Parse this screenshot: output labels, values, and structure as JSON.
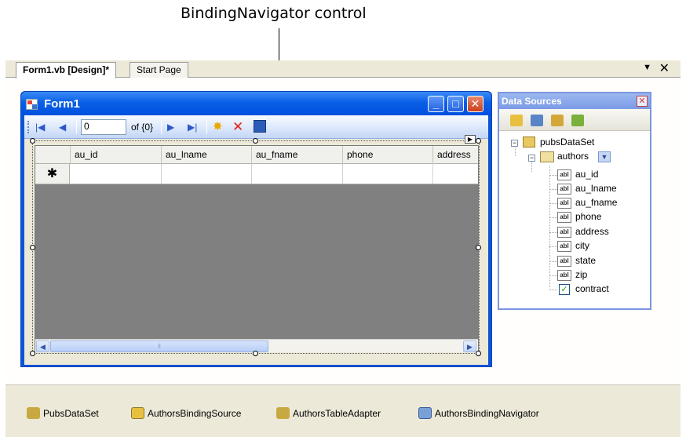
{
  "callout": {
    "label": "BindingNavigator control"
  },
  "document_tabs": [
    {
      "label": "Form1.vb [Design]*",
      "active": true
    },
    {
      "label": "Start Page",
      "active": false
    }
  ],
  "form": {
    "caption": "Form1",
    "navigator": {
      "position_value": "0",
      "count_label": "of {0}"
    },
    "grid": {
      "columns": [
        "au_id",
        "au_lname",
        "au_fname",
        "phone",
        "address"
      ],
      "new_row_marker": "✱"
    }
  },
  "data_sources": {
    "title": "Data Sources",
    "dataset": "pubsDataSet",
    "table": "authors",
    "fields": [
      {
        "name": "au_id",
        "kind": "abl"
      },
      {
        "name": "au_lname",
        "kind": "abl"
      },
      {
        "name": "au_fname",
        "kind": "abl"
      },
      {
        "name": "phone",
        "kind": "abl"
      },
      {
        "name": "address",
        "kind": "abl"
      },
      {
        "name": "city",
        "kind": "abl"
      },
      {
        "name": "state",
        "kind": "abl"
      },
      {
        "name": "zip",
        "kind": "abl"
      },
      {
        "name": "contract",
        "kind": "checkbox"
      }
    ],
    "field_kind_label": "abl"
  },
  "tray": {
    "items": [
      "PubsDataSet",
      "AuthorsBindingSource",
      "AuthorsTableAdapter",
      "AuthorsBindingNavigator"
    ]
  },
  "colors": {
    "title_bar_blue": "#0a5fe6",
    "grid_background": "#808080",
    "tray_background": "#ece9d8",
    "close_red": "#c8401c"
  }
}
